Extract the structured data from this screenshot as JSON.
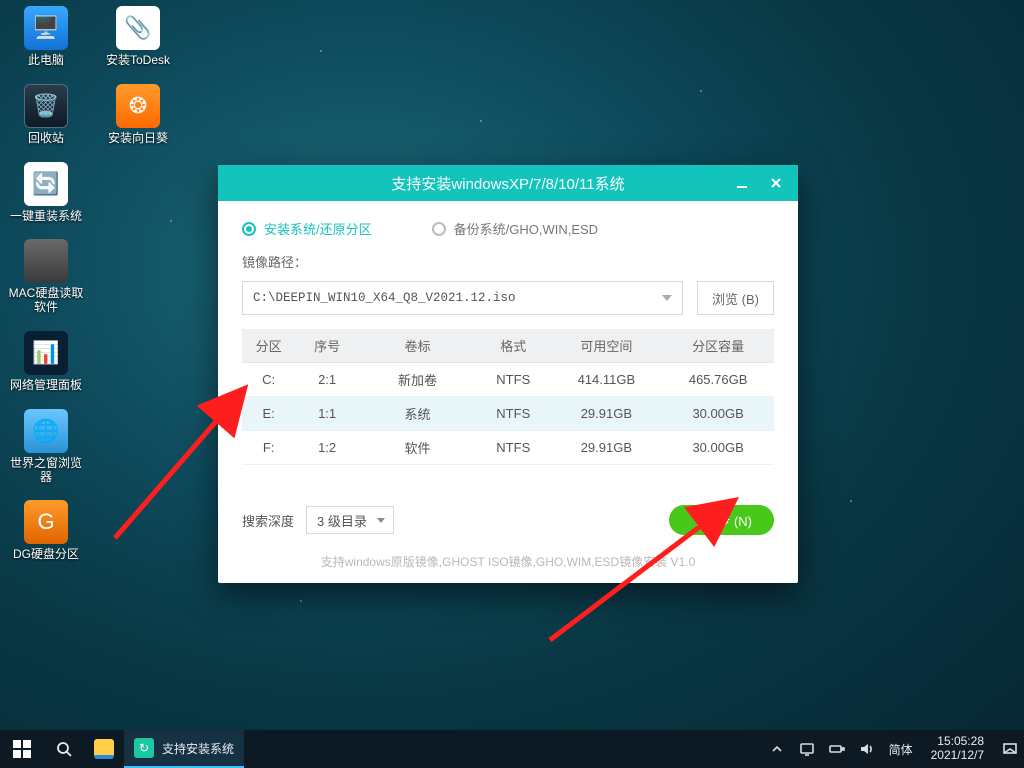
{
  "desktop": {
    "icons": [
      {
        "label": "此电脑"
      },
      {
        "label": "安装ToDesk"
      },
      {
        "label": "回收站"
      },
      {
        "label": "安装向日葵"
      },
      {
        "label": "一键重装系统"
      },
      {
        "label": "MAC硬盘读取软件"
      },
      {
        "label": "网络管理面板"
      },
      {
        "label": "世界之窗浏览器"
      },
      {
        "label": "DG硬盘分区"
      }
    ]
  },
  "installer": {
    "title": "支持安装windowsXP/7/8/10/11系统",
    "tab_install": "安装系统/还原分区",
    "tab_backup": "备份系统/GHO,WIN,ESD",
    "path_label": "镜像路径：",
    "path_value": "C:\\DEEPIN_WIN10_X64_Q8_V2021.12.iso",
    "browse_label": "浏览 (B)",
    "columns": {
      "part": "分区",
      "index": "序号",
      "volume": "卷标",
      "fs": "格式",
      "free": "可用空间",
      "total": "分区容量"
    },
    "rows": [
      {
        "part": "C:",
        "index": "2:1",
        "volume": "新加卷",
        "fs": "NTFS",
        "free": "414.11GB",
        "total": "465.76GB",
        "selected": false
      },
      {
        "part": "E:",
        "index": "1:1",
        "volume": "系统",
        "fs": "NTFS",
        "free": "29.91GB",
        "total": "30.00GB",
        "selected": true
      },
      {
        "part": "F:",
        "index": "1:2",
        "volume": "软件",
        "fs": "NTFS",
        "free": "29.91GB",
        "total": "30.00GB",
        "selected": false
      }
    ],
    "depth_label": "搜索深度",
    "depth_value": "3 级目录",
    "next_label": "下一步 (N)",
    "footer": "支持windows原版镜像,GHOST ISO镜像,GHO,WIM,ESD镜像安装   V1.0"
  },
  "taskbar": {
    "task_label": "支持安装系统",
    "ime": "简体",
    "time": "15:05:28",
    "date": "2021/12/7"
  }
}
